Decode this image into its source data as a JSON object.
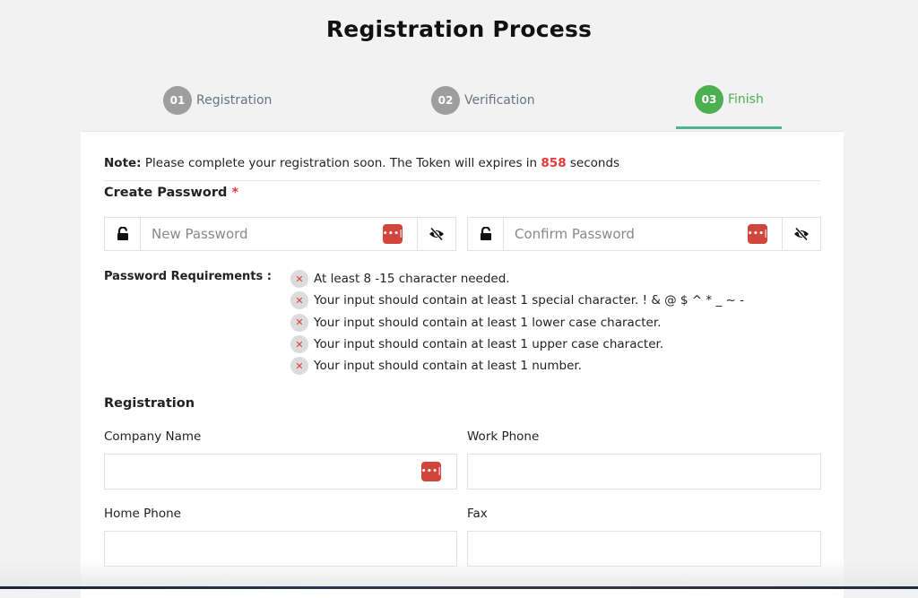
{
  "page": {
    "title": "Registration Process"
  },
  "steps": [
    {
      "number": "01",
      "label": "Registration",
      "active": false
    },
    {
      "number": "02",
      "label": "Verification",
      "active": false
    },
    {
      "number": "03",
      "label": "Finish",
      "active": true
    }
  ],
  "note": {
    "prefix": "Note:",
    "text_before": " Please complete your registration soon. The Token will expires in ",
    "seconds": "858",
    "text_after": " seconds"
  },
  "create_password": {
    "label": "Create Password",
    "required_marker": "*",
    "new_password": {
      "placeholder": "New Password",
      "value": ""
    },
    "confirm_password": {
      "placeholder": "Confirm Password",
      "value": ""
    },
    "password_manager_icon_text": "•••|"
  },
  "requirements": {
    "title": "Password Requirements :",
    "status_icon": "x-mark-icon",
    "status_color": "#e53935",
    "items": [
      "At least 8 -15 character needed.",
      "Your input should contain at least 1 special character. ! & @ $ ^ * _ ~ -",
      "Your input should contain at least 1 lower case character.",
      "Your input should contain at least 1 upper case character.",
      "Your input should contain at least 1 number."
    ]
  },
  "registration": {
    "heading": "Registration",
    "fields": {
      "company_name": {
        "label": "Company Name",
        "value": ""
      },
      "work_phone": {
        "label": "Work Phone",
        "value": ""
      },
      "home_phone": {
        "label": "Home Phone",
        "value": ""
      },
      "fax": {
        "label": "Fax",
        "value": ""
      }
    }
  },
  "colors": {
    "active_step": "#4caf50",
    "inactive_step": "#9e9e9e",
    "active_underline": "#52b394",
    "countdown": "#e53935",
    "password_manager_badge": "#d0453c"
  }
}
